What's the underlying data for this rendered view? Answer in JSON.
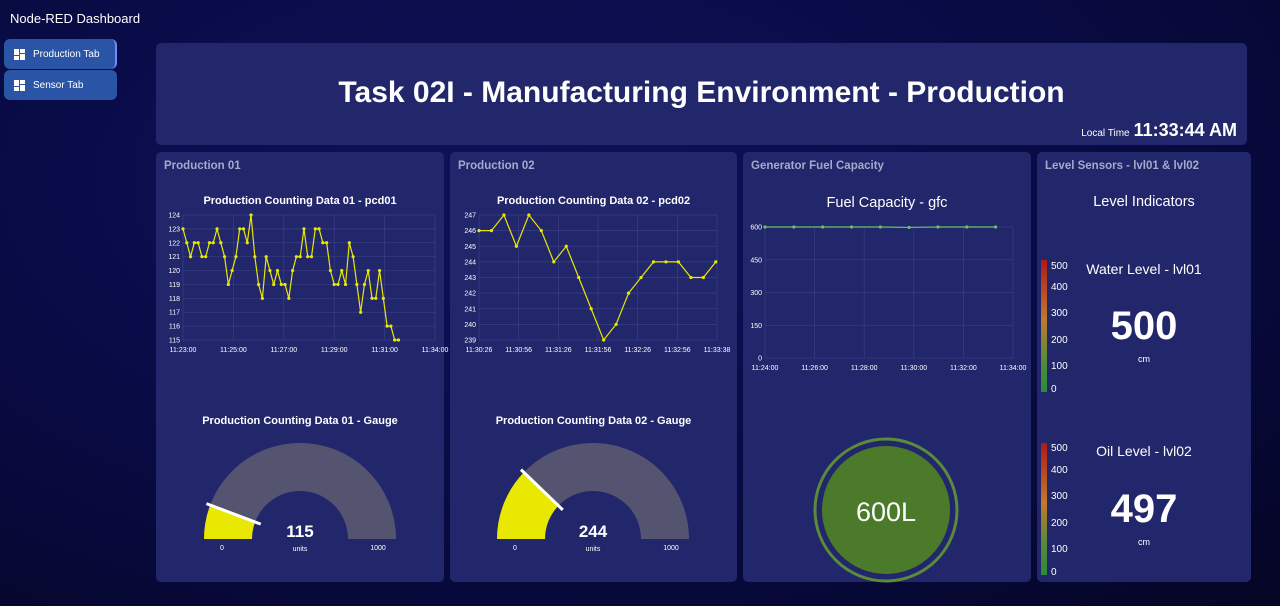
{
  "app": {
    "title": "Node-RED Dashboard"
  },
  "nav": [
    {
      "label": "Production Tab",
      "icon": "dashboard-icon",
      "active": true
    },
    {
      "label": "Sensor Tab",
      "icon": "dashboard-icon",
      "active": false
    }
  ],
  "header": {
    "title": "Task 02I - Manufacturing Environment - Production",
    "time_label": "Local Time",
    "time_value": "11:33:44 AM"
  },
  "panels": {
    "p1": {
      "title": "Production 01",
      "chart_title": "Production Counting Data 01 - pcd01",
      "gauge_title": "Production Counting Data 01 - Gauge",
      "gauge_value": "115",
      "gauge_unit": "units",
      "gauge_min": "0",
      "gauge_max": "1000"
    },
    "p2": {
      "title": "Production 02",
      "chart_title": "Production Counting Data 02 - pcd02",
      "gauge_title": "Production Counting Data 02 - Gauge",
      "gauge_value": "244",
      "gauge_unit": "units",
      "gauge_min": "0",
      "gauge_max": "1000"
    },
    "p3": {
      "title": "Generator Fuel Capacity",
      "chart_title": "Fuel Capacity - gfc",
      "donut_value": "600L"
    },
    "p4": {
      "title": "Level Sensors - lvl01 & lvl02",
      "section_title": "Level Indicators",
      "water_label": "Water Level - lvl01",
      "water_value": "500",
      "water_unit": "cm",
      "oil_label": "Oil Level - lvl02",
      "oil_value": "497",
      "oil_unit": "cm",
      "scale": [
        "500",
        "400",
        "300",
        "200",
        "100",
        "0"
      ]
    }
  },
  "colors": {
    "line_yellow": "#e8e800",
    "gauge_fill": "#e8e800",
    "gauge_track": "#545470",
    "fuel_line": "#6bbf6b",
    "donut_fill": "#4a7a2a",
    "donut_ring": "#5a8a3a"
  },
  "chart_data": [
    {
      "type": "line",
      "title": "Production Counting Data 01 - pcd01",
      "x_ticks": [
        "11:23:00",
        "11:25:00",
        "11:27:00",
        "11:29:00",
        "11:31:00",
        "11:34:00"
      ],
      "y_ticks": [
        "124",
        "123",
        "122",
        "121",
        "120",
        "119",
        "118",
        "117",
        "116",
        "115"
      ],
      "ylim": [
        115,
        124
      ],
      "series": [
        {
          "values": [
            123,
            122,
            121,
            122,
            122,
            121,
            121,
            122,
            122,
            123,
            122,
            121,
            119,
            120,
            121,
            123,
            123,
            122,
            124,
            121,
            119,
            118,
            121,
            120,
            119,
            120,
            119,
            119,
            118,
            120,
            121,
            121,
            123,
            121,
            121,
            123,
            123,
            122,
            122,
            120,
            119,
            119,
            120,
            119,
            122,
            121,
            119,
            117,
            119,
            120,
            118,
            118,
            120,
            118,
            116,
            116,
            115,
            115
          ]
        }
      ]
    },
    {
      "type": "line",
      "title": "Production Counting Data 02 - pcd02",
      "x_ticks": [
        "11:30:26",
        "11:30:56",
        "11:31:26",
        "11:31:56",
        "11:32:26",
        "11:32:56",
        "11:33:38"
      ],
      "y_ticks": [
        "247",
        "246",
        "245",
        "244",
        "243",
        "242",
        "241",
        "240",
        "239"
      ],
      "ylim": [
        239,
        247
      ],
      "series": [
        {
          "values": [
            246,
            246,
            247,
            245,
            247,
            246,
            244,
            245,
            243,
            241,
            239,
            240,
            242,
            243,
            244,
            244,
            244,
            243,
            243,
            244
          ]
        }
      ]
    },
    {
      "type": "line",
      "title": "Fuel Capacity - gfc",
      "x_ticks": [
        "11:24:00",
        "11:26:00",
        "11:28:00",
        "11:30:00",
        "11:32:00",
        "11:34:00"
      ],
      "y_ticks": [
        "600",
        "450",
        "300",
        "150",
        "0"
      ],
      "ylim": [
        0,
        600
      ],
      "series": [
        {
          "values": [
            600,
            600,
            600,
            600,
            600,
            598,
            600,
            600,
            600
          ]
        }
      ]
    },
    {
      "type": "gauge",
      "title": "Production Counting Data 01 - Gauge",
      "value": 115,
      "min": 0,
      "max": 1000
    },
    {
      "type": "gauge",
      "title": "Production Counting Data 02 - Gauge",
      "value": 244,
      "min": 0,
      "max": 1000
    }
  ]
}
